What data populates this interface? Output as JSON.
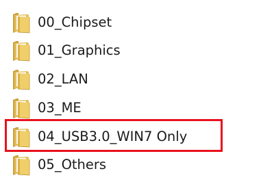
{
  "folders": [
    {
      "label": "00_Chipset",
      "icon": "folder-icon"
    },
    {
      "label": "01_Graphics",
      "icon": "folder-icon"
    },
    {
      "label": "02_LAN",
      "icon": "folder-icon"
    },
    {
      "label": "03_ME",
      "icon": "folder-icon"
    },
    {
      "label": "04_USB3.0_WIN7 Only",
      "icon": "folder-icon",
      "highlighted": true
    },
    {
      "label": "05_Others",
      "icon": "folder-icon"
    }
  ],
  "colors": {
    "highlight": "#e8101c",
    "folder_body": "#e8c15a",
    "folder_back": "#d9a93a",
    "text": "#1a1a1a"
  }
}
